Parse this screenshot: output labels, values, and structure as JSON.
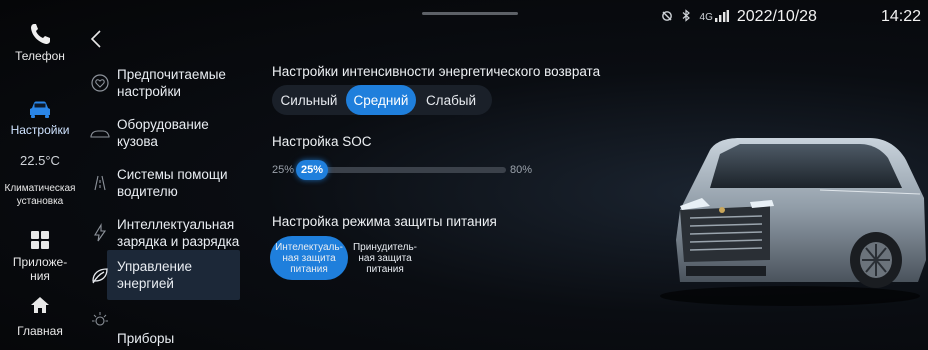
{
  "status_bar": {
    "icons": [
      "location-off-icon",
      "bluetooth-icon"
    ],
    "signal": "4G",
    "date": "2022/10/28",
    "time": "14:22"
  },
  "dock": {
    "phone": "Телефон",
    "settings": "Настройки",
    "climate_temp": "22.5°C",
    "climate_label_1": "Климатическая",
    "climate_label_2": "установка",
    "apps_1": "Приложе-",
    "apps_2": "ния",
    "home": "Главная"
  },
  "menu": {
    "items": [
      {
        "label_1": "Предпочитаемые",
        "label_2": "настройки",
        "icon": "heart-icon"
      },
      {
        "label_1": "Оборудование",
        "label_2": "кузова",
        "icon": "car-body-icon"
      },
      {
        "label_1": "Системы помощи",
        "label_2": "водителю",
        "icon": "lane-assist-icon"
      },
      {
        "label_1": "Интеллектуальная",
        "label_2": "зарядка и разрядка",
        "icon": "charging-icon"
      },
      {
        "label_1": "Управление",
        "label_2": "энергией",
        "icon": "leaf-icon"
      },
      {
        "label_1": "Приборы освещения",
        "label_2": "",
        "icon": "light-icon"
      }
    ],
    "selected_index": 4
  },
  "regen": {
    "title": "Настройки интенсивности энергетического возврата",
    "options": [
      "Сильный",
      "Средний",
      "Слабый"
    ],
    "selected": "Средний"
  },
  "soc": {
    "title": "Настройка SOC",
    "min_label": "25%",
    "value_label": "25%",
    "max_label": "80%",
    "value_fraction": 0.0
  },
  "protection": {
    "title": "Настройка режима защиты питания",
    "option1_l1": "Интелектуаль-",
    "option1_l2": "ная защита",
    "option1_l3": "питания",
    "option2_l1": "Принудитель-",
    "option2_l2": "ная защита",
    "option2_l3": "питания",
    "selected_index": 0
  },
  "colors": {
    "accent": "#1f7fdc",
    "background": "#07090c"
  }
}
